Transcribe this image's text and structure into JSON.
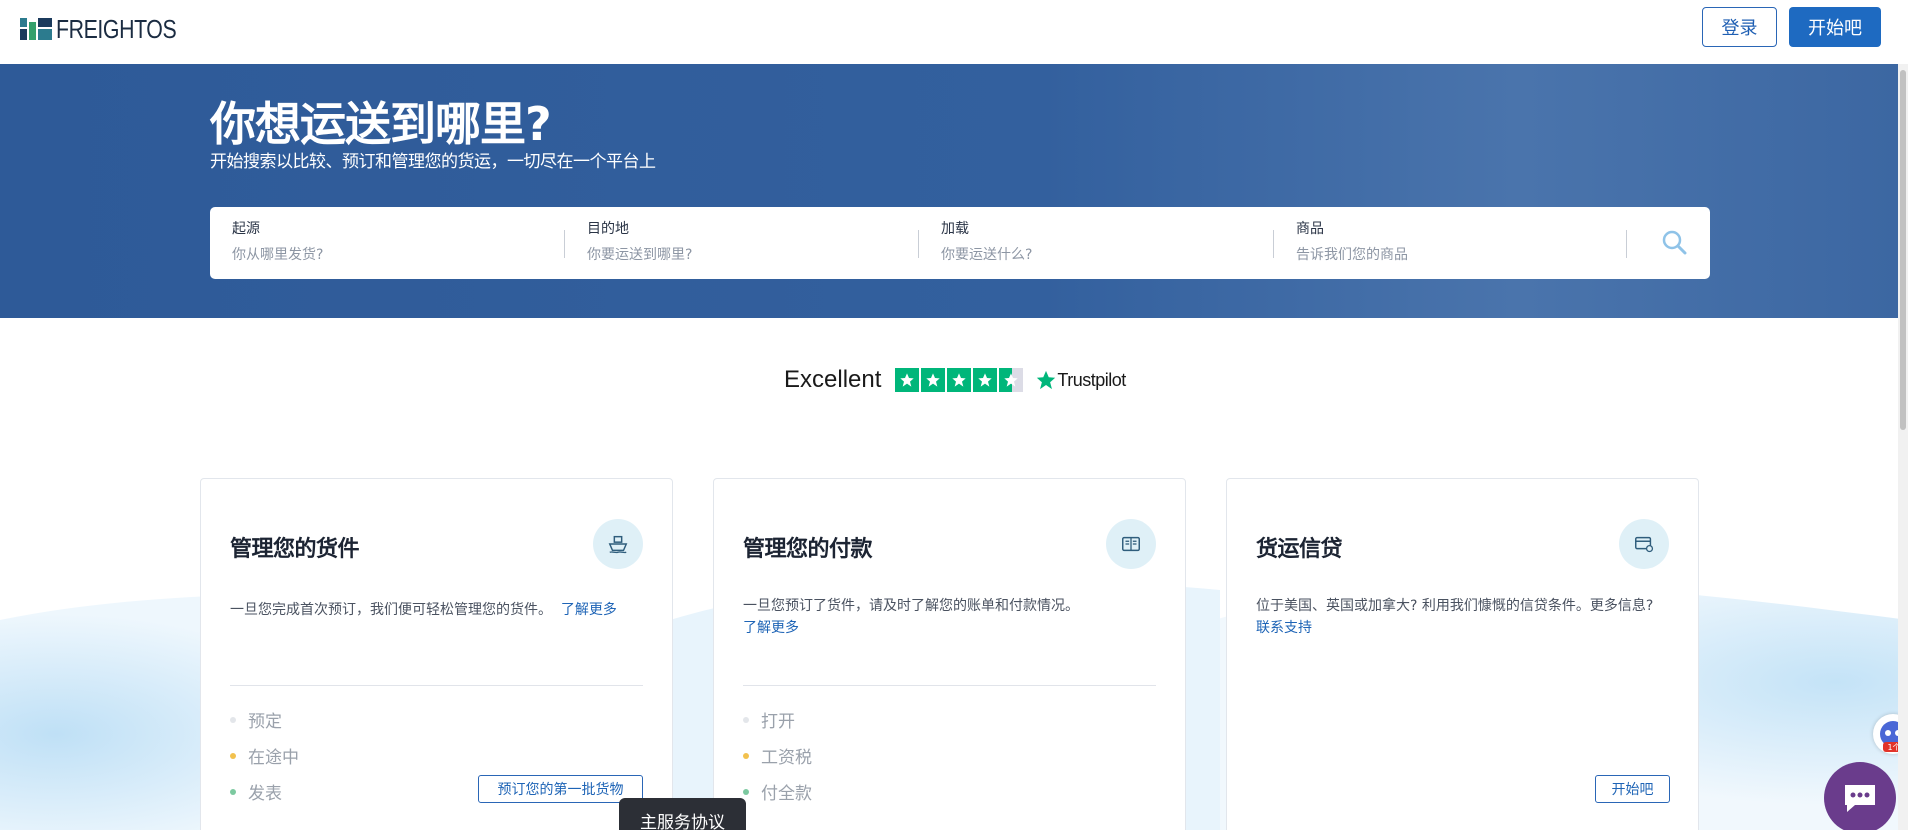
{
  "header": {
    "logo_text": "FREIGHTOS",
    "login_label": "登录",
    "start_label": "开始吧"
  },
  "hero": {
    "title": "你想运送到哪里?",
    "subtitle": "开始搜索以比较、预订和管理您的货运，一切尽在一个平台上",
    "fields": [
      {
        "label": "起源",
        "placeholder": "你从哪里发货?"
      },
      {
        "label": "目的地",
        "placeholder": "你要运送到哪里?"
      },
      {
        "label": "加载",
        "placeholder": "你要运送什么?"
      },
      {
        "label": "商品",
        "placeholder": "告诉我们您的商品"
      }
    ]
  },
  "trustpilot": {
    "rating_word": "Excellent",
    "brand": "Trustpilot",
    "stars": 4.5
  },
  "cards": [
    {
      "title": "管理您的货件",
      "icon": "ship-icon",
      "description": "一旦您完成首次预订，我们便可轻松管理您的货件。",
      "link": "了解更多",
      "stats": [
        "预定",
        "在途中",
        "发表"
      ],
      "button": "预订您的第一批货物"
    },
    {
      "title": "管理您的付款",
      "icon": "invoice-icon",
      "description": "一旦您预订了货件，请及时了解您的账单和付款情况。",
      "link": "了解更多",
      "stats": [
        "打开",
        "工资税",
        "付全款"
      ]
    },
    {
      "title": "货运信贷",
      "icon": "credit-card-icon",
      "description": "位于美国、英国或加拿大? 利用我们慷慨的信贷条件。更多信息?",
      "link": "联系支持",
      "button": "开始吧"
    }
  ],
  "overlay": {
    "tab_label": "主服务协议",
    "widget_badge": "1个"
  },
  "colors": {
    "hero": "#2e5a98",
    "primary": "#1e6ac1",
    "trustpilot_green": "#00b67a",
    "dot_gray": "#e3e6ea",
    "dot_yellow": "#f2c14e",
    "dot_green": "#7cc9a0",
    "chat": "#6a3c8c"
  }
}
